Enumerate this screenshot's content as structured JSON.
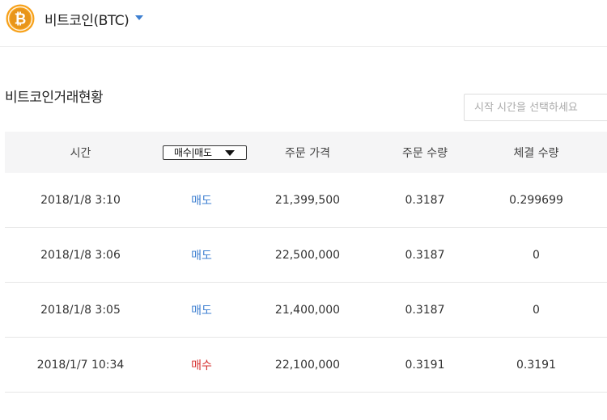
{
  "header": {
    "coin_name": "비트코인(BTC)",
    "logo_icon": "bitcoin-icon",
    "logo_color": "#f7a11a"
  },
  "section": {
    "title": "비트코인거래현황"
  },
  "date_filter": {
    "placeholder": "시작 시간을 선택하세요",
    "value": ""
  },
  "table": {
    "columns": {
      "time": "시간",
      "side_filter": "매수|매도",
      "price": "주문 가격",
      "qty": "주문 수량",
      "filled": "체결 수량"
    },
    "rows": [
      {
        "time": "2018/1/8 3:10",
        "side": "매도",
        "price": "21,399,500",
        "qty": "0.3187",
        "filled": "0.299699"
      },
      {
        "time": "2018/1/8 3:06",
        "side": "매도",
        "price": "22,500,000",
        "qty": "0.3187",
        "filled": "0"
      },
      {
        "time": "2018/1/8 3:05",
        "side": "매도",
        "price": "21,400,000",
        "qty": "0.3187",
        "filled": "0"
      },
      {
        "time": "2018/1/7 10:34",
        "side": "매수",
        "price": "22,100,000",
        "qty": "0.3191",
        "filled": "0.3191"
      }
    ]
  },
  "colors": {
    "sell": "#3d7fd1",
    "buy": "#d6312f",
    "header_bg": "#f5f5f6"
  }
}
